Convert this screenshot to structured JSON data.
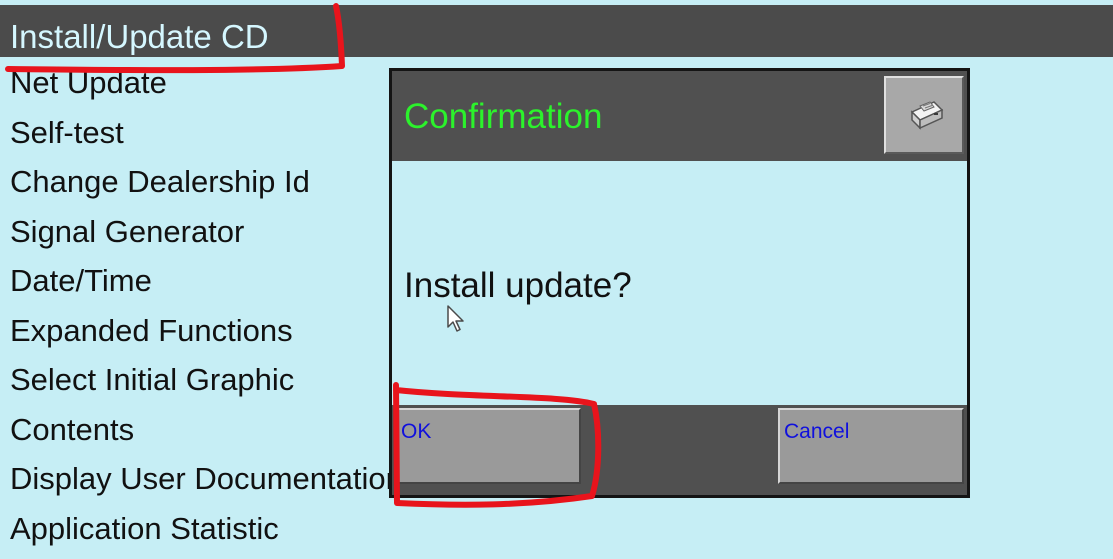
{
  "window": {
    "title": "Install/Update CD"
  },
  "menu": {
    "items": [
      {
        "label": "Net Update"
      },
      {
        "label": "Self-test"
      },
      {
        "label": "Change Dealership Id"
      },
      {
        "label": "Signal Generator"
      },
      {
        "label": "Date/Time"
      },
      {
        "label": "Expanded Functions"
      },
      {
        "label": "Select Initial Graphic"
      },
      {
        "label": "Contents"
      },
      {
        "label": "Display User Documentation"
      },
      {
        "label": "Application Statistic"
      }
    ]
  },
  "dialog": {
    "title": "Confirmation",
    "print_icon": "printer-icon",
    "message": "Install update?",
    "ok_label": "OK",
    "cancel_label": "Cancel"
  },
  "colors": {
    "screen_background": "#c6eef5",
    "title_bar": "#4b4b4b",
    "dialog_title": "#2cf22c",
    "button_text": "#1010dd",
    "annotation": "#e8141c"
  }
}
